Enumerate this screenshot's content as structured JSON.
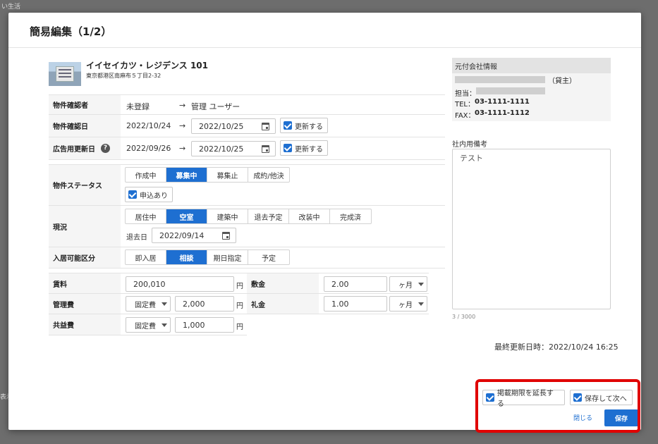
{
  "background": {
    "snippet_top": "い生活",
    "snippet_left": "表示"
  },
  "modal": {
    "title": "簡易編集（1/2）"
  },
  "property": {
    "name": "イイセイカツ・レジデンス 101",
    "address": "東京都港区南麻布５丁目2-32"
  },
  "rows": {
    "confirmer": {
      "label": "物件確認者",
      "old": "未登録",
      "arrow": "→",
      "new": "管理 ユーザー"
    },
    "confirm_date": {
      "label": "物件確認日",
      "old": "2022/10/24",
      "arrow": "→",
      "new": "2022/10/25",
      "update_label": "更新する"
    },
    "ad_update_date": {
      "label": "広告用更新日",
      "help": "?",
      "old": "2022/09/26",
      "arrow": "→",
      "new": "2022/10/25",
      "update_label": "更新する"
    },
    "status": {
      "label": "物件ステータス",
      "options": [
        "作成中",
        "募集中",
        "募集止",
        "成約/他決"
      ],
      "selected": "募集中",
      "application_label": "申込あり"
    },
    "current": {
      "label": "現況",
      "options": [
        "居住中",
        "空室",
        "建築中",
        "退去予定",
        "改装中",
        "完成済"
      ],
      "selected": "空室",
      "moveout_label": "退去日",
      "moveout_date": "2022/09/14"
    },
    "movein": {
      "label": "入居可能区分",
      "options": [
        "即入居",
        "相談",
        "期日指定",
        "予定"
      ],
      "selected": "相談"
    }
  },
  "fees": {
    "rent": {
      "label": "賃料",
      "value": "200,010",
      "unit": "円"
    },
    "management": {
      "label": "管理費",
      "type": "固定費",
      "value": "2,000",
      "unit": "円"
    },
    "common": {
      "label": "共益費",
      "type": "固定費",
      "value": "1,000",
      "unit": "円"
    },
    "deposit": {
      "label": "敷金",
      "value": "2.00",
      "unit": "ヶ月"
    },
    "key_money": {
      "label": "礼金",
      "value": "1.00",
      "unit": "ヶ月"
    }
  },
  "company": {
    "header": "元付会社情報",
    "owner_suffix": "（貸主）",
    "person_label": "担当：",
    "tel_label": "TEL：",
    "tel": "03-1111-1111",
    "fax_label": "FAX：",
    "fax": "03-1111-1112"
  },
  "memo": {
    "label": "社内用備考",
    "value": "テスト",
    "count": "3 / 3000"
  },
  "last_updated": "最終更新日時：2022/10/24 16:25",
  "footer": {
    "extend_label": "掲載期限を延長する",
    "save_next_label": "保存して次へ",
    "close_label": "閉じる",
    "save_label": "保存"
  },
  "colors": {
    "accent": "#1e6fd1",
    "highlight": "#e00000"
  }
}
